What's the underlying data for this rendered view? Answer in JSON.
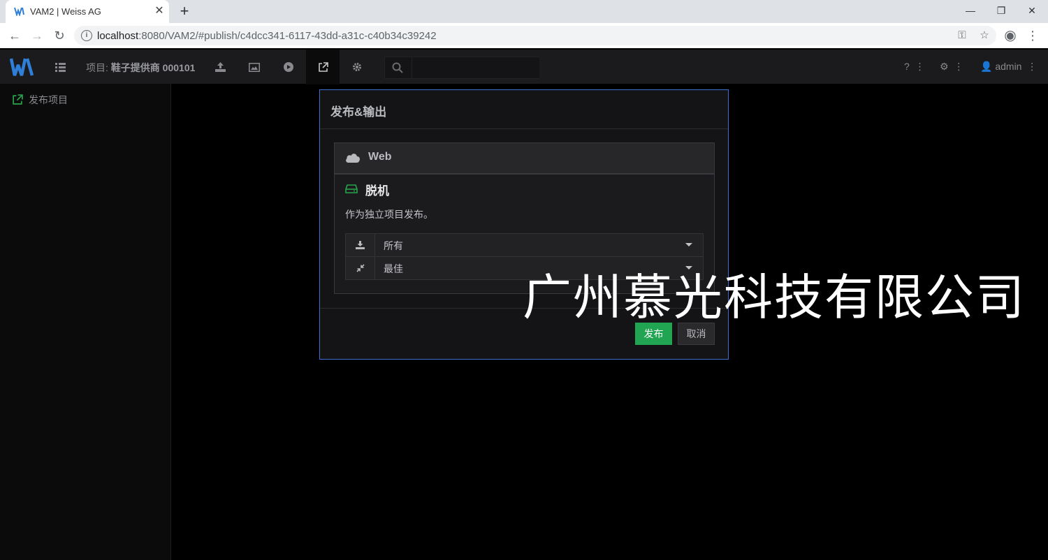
{
  "browser": {
    "tab_title": "VAM2 | Weiss AG",
    "new_tab": "+",
    "url_host": "localhost",
    "url_rest": ":8080/VAM2/#publish/c4dcc341-6117-43dd-a31c-c40b34c39242",
    "window_controls": [
      "minimize-icon",
      "restore-icon",
      "close-icon"
    ]
  },
  "topnav": {
    "project_prefix": "项目:",
    "project_name": "鞋子提供商 000101",
    "nav_icons": [
      "list-icon",
      "upload-icon",
      "image-icon",
      "play-icon",
      "external-link-icon",
      "gear-icon"
    ],
    "active_icon": "external-link-icon",
    "search_placeholder": "",
    "help_label": "?",
    "user_label": "admin"
  },
  "sidebar": {
    "items": [
      {
        "label": "发布项目",
        "icon": "external-link-icon"
      }
    ]
  },
  "modal": {
    "title": "发布&输出",
    "web_panel": {
      "label": "Web",
      "icon": "cloud-icon"
    },
    "offline_panel": {
      "label": "脱机",
      "icon": "drive-icon",
      "description": "作为独立项目发布。",
      "selects": [
        {
          "icon": "download-icon",
          "value": "所有"
        },
        {
          "icon": "compress-icon",
          "value": "最佳"
        }
      ]
    },
    "publish_label": "发布",
    "cancel_label": "取消"
  },
  "watermark": "广州慕光科技有限公司",
  "colors": {
    "accent_green": "#22a552",
    "modal_border": "#3e6fd0",
    "logo_blue": "#2f7fd8"
  }
}
